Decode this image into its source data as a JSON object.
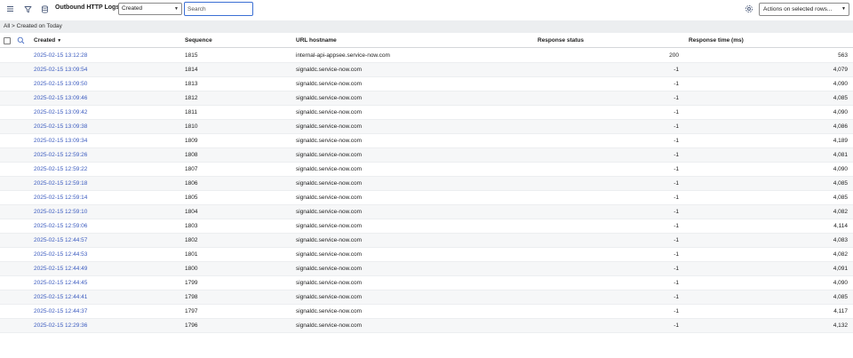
{
  "toolbar": {
    "title": "Outbound HTTP Logs",
    "filter_select": "Created",
    "search_placeholder": "Search",
    "actions_label": "Actions on selected rows..."
  },
  "breadcrumb": "All > Created on Today",
  "columns": {
    "created": "Created",
    "sequence": "Sequence",
    "url_hostname": "URL hostname",
    "response_status": "Response status",
    "response_time": "Response time (ms)"
  },
  "rows": [
    {
      "created": "2025-02-15 13:12:28",
      "sequence": "1815",
      "host": "internal-api-appsee.service-now.com",
      "status": "200",
      "time": "563"
    },
    {
      "created": "2025-02-15 13:09:54",
      "sequence": "1814",
      "host": "signaldc.service-now.com",
      "status": "-1",
      "time": "4,079"
    },
    {
      "created": "2025-02-15 13:09:50",
      "sequence": "1813",
      "host": "signaldc.service-now.com",
      "status": "-1",
      "time": "4,090"
    },
    {
      "created": "2025-02-15 13:09:46",
      "sequence": "1812",
      "host": "signaldc.service-now.com",
      "status": "-1",
      "time": "4,085"
    },
    {
      "created": "2025-02-15 13:09:42",
      "sequence": "1811",
      "host": "signaldc.service-now.com",
      "status": "-1",
      "time": "4,090"
    },
    {
      "created": "2025-02-15 13:09:38",
      "sequence": "1810",
      "host": "signaldc.service-now.com",
      "status": "-1",
      "time": "4,086"
    },
    {
      "created": "2025-02-15 13:09:34",
      "sequence": "1809",
      "host": "signaldc.service-now.com",
      "status": "-1",
      "time": "4,189"
    },
    {
      "created": "2025-02-15 12:59:26",
      "sequence": "1808",
      "host": "signaldc.service-now.com",
      "status": "-1",
      "time": "4,081"
    },
    {
      "created": "2025-02-15 12:59:22",
      "sequence": "1807",
      "host": "signaldc.service-now.com",
      "status": "-1",
      "time": "4,090"
    },
    {
      "created": "2025-02-15 12:59:18",
      "sequence": "1806",
      "host": "signaldc.service-now.com",
      "status": "-1",
      "time": "4,085"
    },
    {
      "created": "2025-02-15 12:59:14",
      "sequence": "1805",
      "host": "signaldc.service-now.com",
      "status": "-1",
      "time": "4,085"
    },
    {
      "created": "2025-02-15 12:59:10",
      "sequence": "1804",
      "host": "signaldc.service-now.com",
      "status": "-1",
      "time": "4,082"
    },
    {
      "created": "2025-02-15 12:59:06",
      "sequence": "1803",
      "host": "signaldc.service-now.com",
      "status": "-1",
      "time": "4,114"
    },
    {
      "created": "2025-02-15 12:44:57",
      "sequence": "1802",
      "host": "signaldc.service-now.com",
      "status": "-1",
      "time": "4,083"
    },
    {
      "created": "2025-02-15 12:44:53",
      "sequence": "1801",
      "host": "signaldc.service-now.com",
      "status": "-1",
      "time": "4,082"
    },
    {
      "created": "2025-02-15 12:44:49",
      "sequence": "1800",
      "host": "signaldc.service-now.com",
      "status": "-1",
      "time": "4,091"
    },
    {
      "created": "2025-02-15 12:44:45",
      "sequence": "1799",
      "host": "signaldc.service-now.com",
      "status": "-1",
      "time": "4,090"
    },
    {
      "created": "2025-02-15 12:44:41",
      "sequence": "1798",
      "host": "signaldc.service-now.com",
      "status": "-1",
      "time": "4,085"
    },
    {
      "created": "2025-02-15 12:44:37",
      "sequence": "1797",
      "host": "signaldc.service-now.com",
      "status": "-1",
      "time": "4,117"
    },
    {
      "created": "2025-02-15 12:29:36",
      "sequence": "1796",
      "host": "signaldc.service-now.com",
      "status": "-1",
      "time": "4,132"
    }
  ],
  "icons": [
    "menu-icon",
    "filter-icon",
    "database-icon",
    "search-icon",
    "gear-icon"
  ],
  "colors": {
    "link": "#3b5bbf",
    "breadcrumb_bg": "#eceef0",
    "focus": "#3b6fd4"
  }
}
